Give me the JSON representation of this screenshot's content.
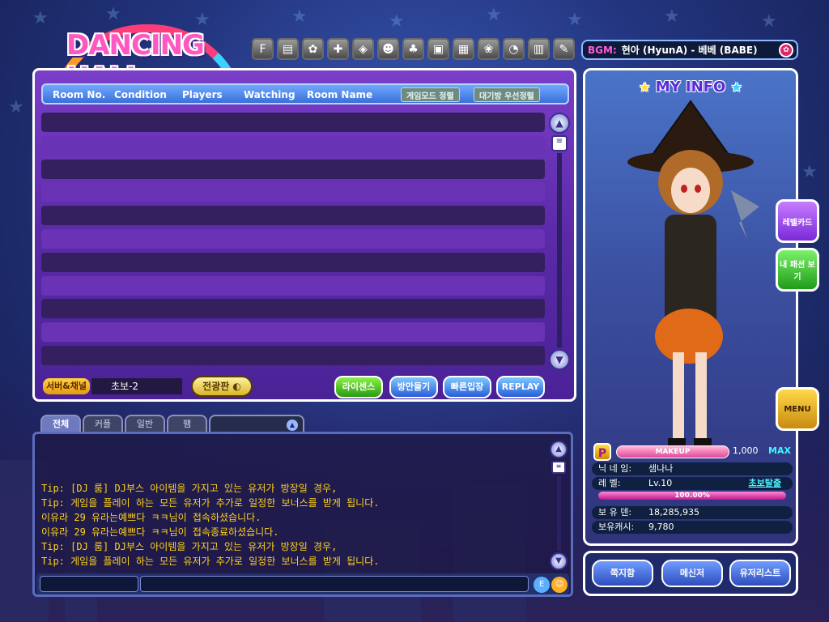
{
  "app": {
    "logo_text": "DANCING HALL"
  },
  "top_icons": [
    {
      "name": "family-icon",
      "glyph": "F",
      "label": "Family"
    },
    {
      "name": "book-icon",
      "glyph": "▤",
      "label": ""
    },
    {
      "name": "bubble-icon",
      "glyph": "✿",
      "label": ""
    },
    {
      "name": "gift-icon",
      "glyph": "✚",
      "label": ""
    },
    {
      "name": "wardrobe-icon",
      "glyph": "◈",
      "label": ""
    },
    {
      "name": "pet-icon",
      "glyph": "☻",
      "label": ""
    },
    {
      "name": "leaf-icon",
      "glyph": "♣",
      "label": ""
    },
    {
      "name": "tv-icon",
      "glyph": "▣",
      "label": ""
    },
    {
      "name": "photo-icon",
      "glyph": "▦",
      "label": "PHOTO"
    },
    {
      "name": "garden-icon",
      "glyph": "❀",
      "label": "Garden"
    },
    {
      "name": "helmet-icon",
      "glyph": "◔",
      "label": ""
    },
    {
      "name": "scroll-icon",
      "glyph": "▥",
      "label": ""
    },
    {
      "name": "story-icon",
      "glyph": "✎",
      "label": "STORY"
    }
  ],
  "bgm": {
    "label": "BGM:",
    "song": "현아 (HyunA) - 베베 (BABE)"
  },
  "room_list": {
    "headers": [
      "Room No.",
      "Condition",
      "Players",
      "Watching",
      "Room Name"
    ],
    "sort_buttons": [
      "게임모드 정렬",
      "대기방 우선정렬"
    ],
    "row_count": 11
  },
  "room_footer": {
    "server_label": "서버&채널",
    "server_value": "초보-2",
    "channel_button": "전광판",
    "buttons": [
      "라이센스",
      "방만들기",
      "빠른입장",
      "REPLAY"
    ]
  },
  "chat": {
    "tabs": [
      "전체",
      "커플",
      "일반",
      "팸"
    ],
    "lines": [
      "Tip: [DJ 룸] DJ부스 아이템을 가지고 있는 유저가 방장일 경우,",
      "Tip: 게임을 플레이 하는 모든 유저가 추가로 일정한 보너스를 받게 됩니다.",
      "이유라  29 유라는예쁘다  ㅋㅋ님이 접속하셨습니다.",
      "이유라  29 유라는예쁘다  ㅋㅋ님이 접속종료하셨습니다.",
      "Tip: [DJ 룸] DJ부스 아이템을 가지고 있는 유저가 방장일 경우,",
      "Tip: 게임을 플레이 하는 모든 유저가 추가로 일정한 보너스를 받게 됩니다."
    ]
  },
  "my_info": {
    "title": "MY INFO",
    "side_buttons": [
      "레벨카드",
      "내 패션 보기",
      "MENU"
    ],
    "makeup_label": "MAKEUP",
    "makeup_value": "1,000",
    "makeup_max": "MAX",
    "nickname_label": "닉 네 임:",
    "nickname": "샘나나",
    "level_label": "레    벨:",
    "level": "Lv.10",
    "level_tag": "초보탈출",
    "exp_percent": "100.00%",
    "den_label": "보 유 덴:",
    "den": "18,285,935",
    "cash_label": "보유캐시:",
    "cash": "9,780"
  },
  "bottom_buttons": [
    "쪽지함",
    "메신저",
    "유저리스트"
  ]
}
